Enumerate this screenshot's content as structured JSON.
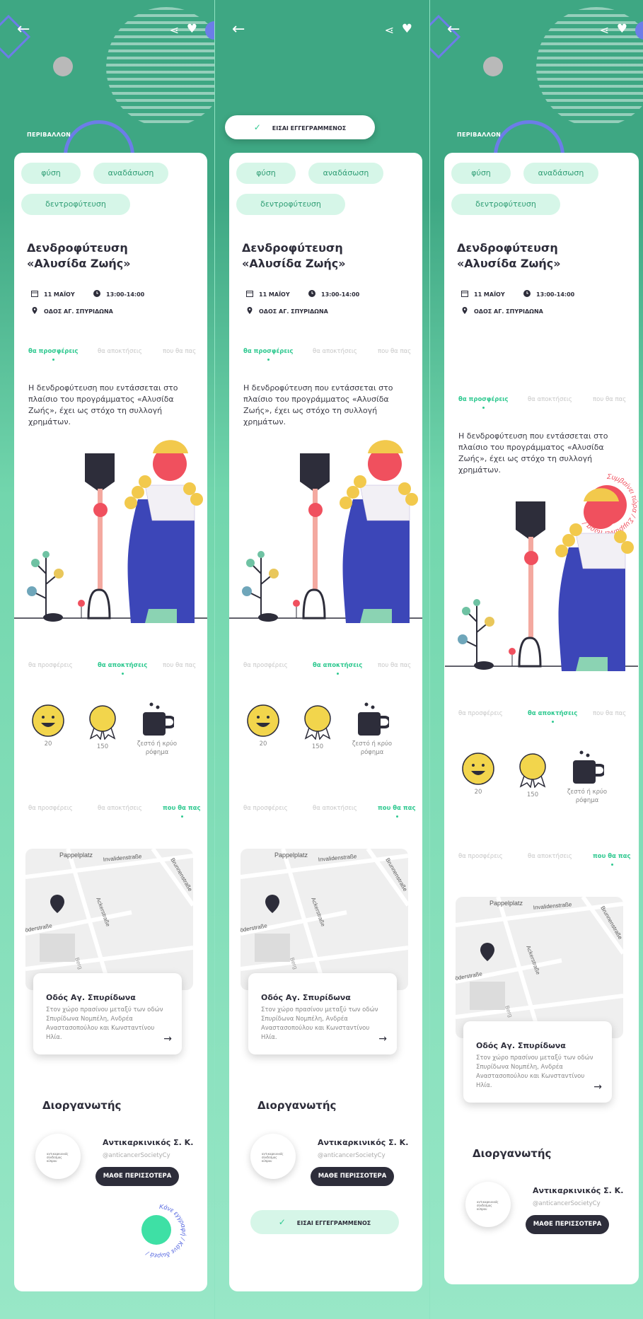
{
  "colors": {
    "brand_green": "#3ea783",
    "accent": "#2fc990",
    "chip_bg": "#d6f6e8",
    "dark": "#2d2d3a",
    "badge_red": "#f0505e",
    "fab": "#3ee0a5"
  },
  "header": {
    "back_icon": "arrow-left-icon",
    "share_icon": "share-icon",
    "favorite_icon": "heart-icon"
  },
  "category": "ΠΕΡΙΒΑΛΛΟΝ",
  "tags": [
    "φύση",
    "αναδάσωση",
    "δεντροφύτευση"
  ],
  "event": {
    "title": "Δενδροφύτευση «Αλυσίδα Ζωής»",
    "date": "11 ΜΑΪΟΥ",
    "time": "13:00-14:00",
    "location": "ΟΔΟΣ ΑΓ. ΣΠΥΡΙΔΩΝΑ"
  },
  "tabs": [
    "θα προσφέρεις",
    "θα αποκτήσεις",
    "που θα πας"
  ],
  "description": "Η δενδροφύτευση που εντάσσεται στο πλαίσιο του προγράμματος «Αλυσίδα Ζωής», έχει ως στόχο τη συλλογή χρημάτων.",
  "rewards": [
    {
      "icon": "smiley-icon",
      "label": "20"
    },
    {
      "icon": "medal-icon",
      "label": "150"
    },
    {
      "icon": "mug-icon",
      "label": "ζεστό ή κρύο ρόφημα"
    }
  ],
  "map": {
    "streets": [
      "Pappelplatz",
      "Invalidenstraße",
      "Ackerstraße",
      "Brunnenstraße",
      "öderstraße",
      "Berg"
    ],
    "place_title": "Οδός Αγ. Σπυρίδωνα",
    "place_desc": "Στον χώρο πρασίνου μεταξύ των οδών Σπυρίδωνα Νομπέλη, Ανδρέα Αναστασοπούλου και Κωνσταντίνου Ηλία."
  },
  "organizer": {
    "heading": "Διοργανωτής",
    "name": "Αντικαρκινικός Σ. Κ.",
    "handle": "@anticancerSocietyCy",
    "learn_more": "ΜΑΘΕ ΠΕΡΙΣΣΟΤΕΡΑ",
    "logo_text": "αντικαρκινικός σύνδεσμος κύπρου"
  },
  "register_fab": {
    "arc_text": "Κάνε εγγραφή / Κάνε δωρεά /"
  },
  "registered": {
    "label": "ΕΙΣΑΙ ΕΓΓΕΓΡΑΜΜΕΝΟΣ"
  },
  "live_badge": {
    "arc_text": "Συμβαίνει τώρα / Συμβαίνει τώρα /"
  }
}
